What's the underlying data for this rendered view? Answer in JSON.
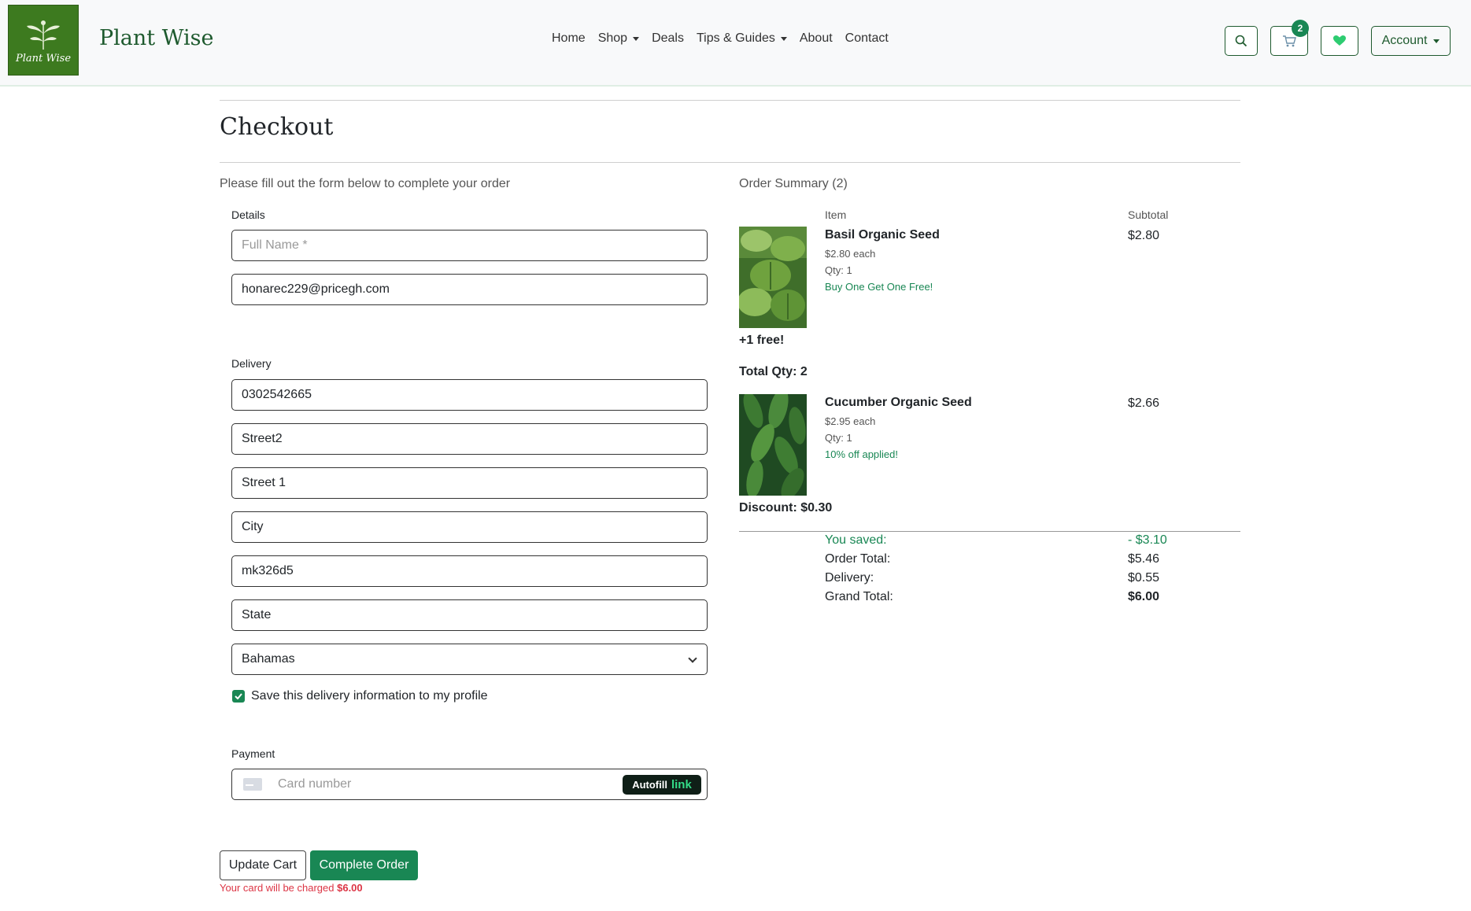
{
  "header": {
    "brand": "Plant Wise",
    "logo_text": "Plant Wise",
    "nav": [
      {
        "label": "Home",
        "dropdown": false
      },
      {
        "label": "Shop",
        "dropdown": true
      },
      {
        "label": "Deals",
        "dropdown": false
      },
      {
        "label": "Tips & Guides",
        "dropdown": true
      },
      {
        "label": "About",
        "dropdown": false
      },
      {
        "label": "Contact",
        "dropdown": false
      }
    ],
    "cart_count": "2",
    "account_label": "Account",
    "icons": {
      "search": "search-icon",
      "cart": "cart-icon",
      "wishlist": "heart-icon"
    }
  },
  "page": {
    "title": "Checkout",
    "intro": "Please fill out the form below to complete your order"
  },
  "form": {
    "details_label": "Details",
    "full_name_placeholder": "Full Name *",
    "email_value": "honarec229@pricegh.com",
    "delivery_label": "Delivery",
    "phone_value": "0302542665",
    "street2_value": "Street2",
    "street1_value": "Street 1",
    "city_value": "City",
    "postcode_value": "mk326d5",
    "state_value": "State",
    "country_value": "Bahamas",
    "save_delivery_label": "Save this delivery information to my profile",
    "save_delivery_checked": true,
    "payment_label": "Payment",
    "card_placeholder": "Card number",
    "autofill_label": "Autofill",
    "autofill_link": "link",
    "update_cart_label": "Update Cart",
    "complete_order_label": "Complete Order",
    "charge_note": "Your card will be charged ",
    "charge_amount": "$6.00"
  },
  "summary": {
    "title": "Order Summary (2)",
    "col_item": "Item",
    "col_subtotal": "Subtotal",
    "items": [
      {
        "name": "Basil Organic Seed",
        "price_each": "$2.80 each",
        "qty": "Qty: 1",
        "promo": "Buy One Get One Free!",
        "subtotal": "$2.80",
        "extra_1": "+1 free!",
        "extra_2": "Total Qty: 2"
      },
      {
        "name": "Cucumber Organic Seed",
        "price_each": "$2.95 each",
        "qty": "Qty: 1",
        "promo": "10% off applied!",
        "subtotal": "$2.66",
        "extra_1": "Discount: $0.30"
      }
    ],
    "totals": {
      "saved_label": "You saved:",
      "saved_value": "- $3.10",
      "order_total_label": "Order Total:",
      "order_total_value": "$5.46",
      "delivery_label": "Delivery:",
      "delivery_value": "$0.55",
      "grand_total_label": "Grand Total:",
      "grand_total_value": "$6.00"
    }
  },
  "colors": {
    "brand_green": "#1e5a2e",
    "accent_green": "#198754",
    "danger": "#dc3545"
  }
}
